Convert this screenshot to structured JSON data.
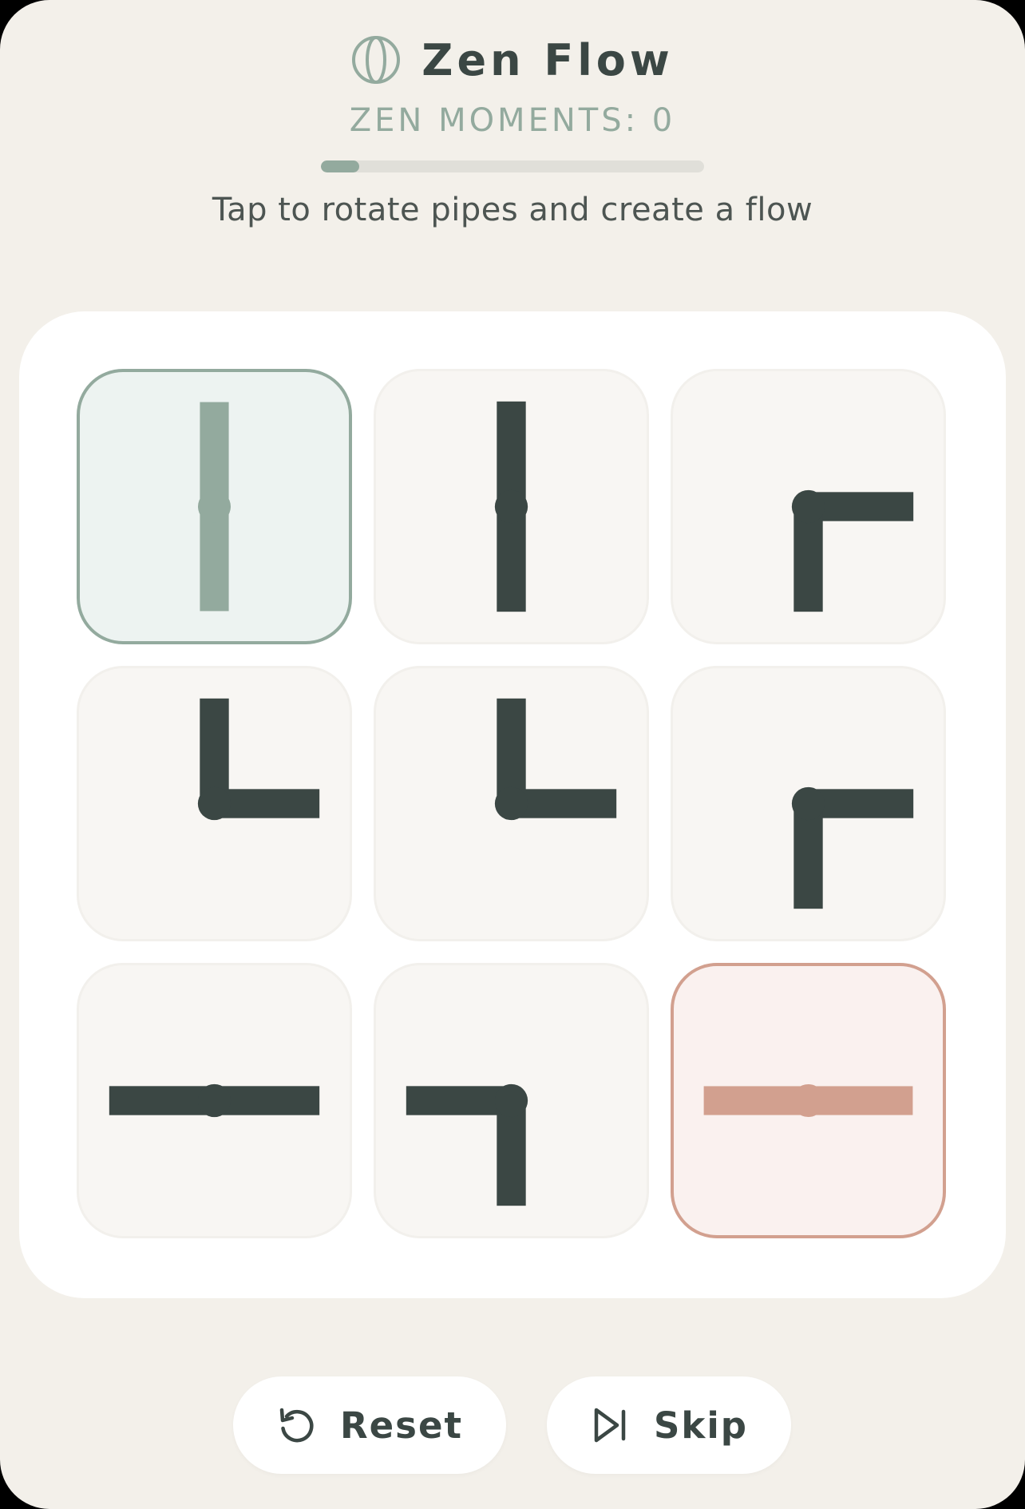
{
  "header": {
    "title": "Zen Flow",
    "title_icon": "zen-circle-icon",
    "moments_text": "ZEN MOMENTS: 0",
    "progress_fraction": 0.1,
    "hint": "Tap to rotate pipes and create a flow"
  },
  "colors": {
    "background": "#f3f0ea",
    "accent_green": "#93aa9e",
    "accent_terracotta": "#d2a08f",
    "pipe_dark": "#3b4744",
    "board": "#ffffff"
  },
  "board": {
    "rows": 3,
    "cols": 3,
    "tiles": [
      {
        "kind": "start",
        "pipe": "straight",
        "connects": [
          "N",
          "S"
        ]
      },
      {
        "kind": "normal",
        "pipe": "straight",
        "connects": [
          "N",
          "S"
        ]
      },
      {
        "kind": "normal",
        "pipe": "elbow",
        "connects": [
          "E",
          "S"
        ]
      },
      {
        "kind": "normal",
        "pipe": "elbow",
        "connects": [
          "N",
          "E"
        ]
      },
      {
        "kind": "normal",
        "pipe": "elbow",
        "connects": [
          "N",
          "E"
        ]
      },
      {
        "kind": "normal",
        "pipe": "elbow",
        "connects": [
          "E",
          "S"
        ]
      },
      {
        "kind": "normal",
        "pipe": "straight",
        "connects": [
          "W",
          "E"
        ]
      },
      {
        "kind": "normal",
        "pipe": "elbow",
        "connects": [
          "W",
          "S"
        ]
      },
      {
        "kind": "end",
        "pipe": "straight",
        "connects": [
          "W",
          "E"
        ]
      }
    ]
  },
  "buttons": {
    "reset_label": "Reset",
    "reset_icon": "rotate-ccw-icon",
    "skip_label": "Skip",
    "skip_icon": "skip-forward-icon"
  }
}
